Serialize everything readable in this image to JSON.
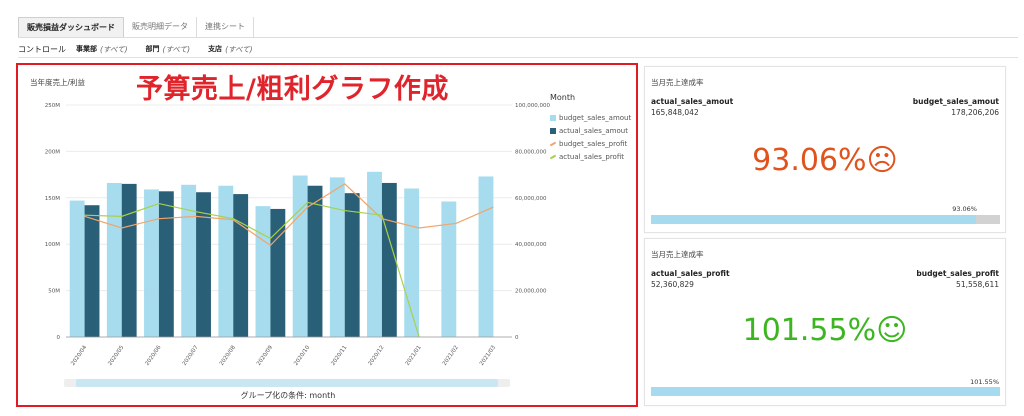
{
  "tabs": [
    {
      "label": "販売損益ダッシュボード",
      "active": true
    },
    {
      "label": "販売明細データ",
      "active": false
    },
    {
      "label": "連携シート",
      "active": false
    }
  ],
  "controls": {
    "title": "コントロール",
    "filters": [
      {
        "label": "事業部",
        "value": "(すべて)"
      },
      {
        "label": "部門",
        "value": "(すべて)"
      },
      {
        "label": "支店",
        "value": "(すべて)"
      }
    ]
  },
  "chart_panel": {
    "title": "当年度売上/利益",
    "overlay_title": "予算売上/粗利グラフ作成",
    "legend_title": "Month",
    "group_label": "グループ化の条件: month",
    "colors": {
      "budget_bar": "#a6dcee",
      "actual_bar": "#2a5f78",
      "budget_line": "#f0a56a",
      "actual_line": "#a8d14a",
      "frame": "#e11b22"
    }
  },
  "chart_data": {
    "type": "bar",
    "categories": [
      "2020/04",
      "2020/05",
      "2020/06",
      "2020/07",
      "2020/08",
      "2020/09",
      "2020/10",
      "2020/11",
      "2020/12",
      "2021/01",
      "2021/02",
      "2021/03"
    ],
    "series": [
      {
        "name": "budget_sales_amout",
        "kind": "bar",
        "axis": "left",
        "values": [
          147,
          166,
          159,
          164,
          163,
          141,
          174,
          172,
          178,
          160,
          146,
          173
        ]
      },
      {
        "name": "actual_sales_amout",
        "kind": "bar",
        "axis": "left",
        "values": [
          142,
          165,
          157,
          156,
          154,
          138,
          163,
          155,
          166,
          null,
          null,
          null
        ]
      },
      {
        "name": "budget_sales_profit",
        "kind": "line",
        "axis": "right",
        "values": [
          52000000,
          47000000,
          51000000,
          52000000,
          50500000,
          39500000,
          56000000,
          66000000,
          51000000,
          47000000,
          49000000,
          56000000
        ]
      },
      {
        "name": "actual_sales_profit",
        "kind": "line",
        "axis": "right",
        "values": [
          52500000,
          52000000,
          57500000,
          54000000,
          51000000,
          42500000,
          58000000,
          54500000,
          52500000,
          0,
          null,
          null
        ]
      }
    ],
    "left_axis": {
      "ylim": [
        0,
        250
      ],
      "ticks": [
        "0",
        "50M",
        "100M",
        "150M",
        "200M",
        "250M"
      ]
    },
    "right_axis": {
      "ylim": [
        0,
        100000000
      ],
      "ticks": [
        "0",
        "20,000,000",
        "40,000,000",
        "60,000,000",
        "80,000,000",
        "100,000,000"
      ]
    },
    "grid": true,
    "legend": "right"
  },
  "kpi1": {
    "title": "当月売上達成率",
    "left_label": "actual_sales_amout",
    "left_value": "165,848,042",
    "right_label": "budget_sales_amout",
    "right_value": "178,206,206",
    "big_value": "93.06%",
    "face": "☹",
    "color": "#e0531d",
    "progress": 0.9306,
    "progress_label": "93.06%"
  },
  "kpi2": {
    "title": "当月売上達成率",
    "left_label": "actual_sales_profit",
    "left_value": "52,360,829",
    "right_label": "budget_sales_profit",
    "right_value": "51,558,611",
    "big_value": "101.55%",
    "face": "☺",
    "color": "#3cb521",
    "progress": 1.0,
    "progress_label": "101.55%"
  }
}
